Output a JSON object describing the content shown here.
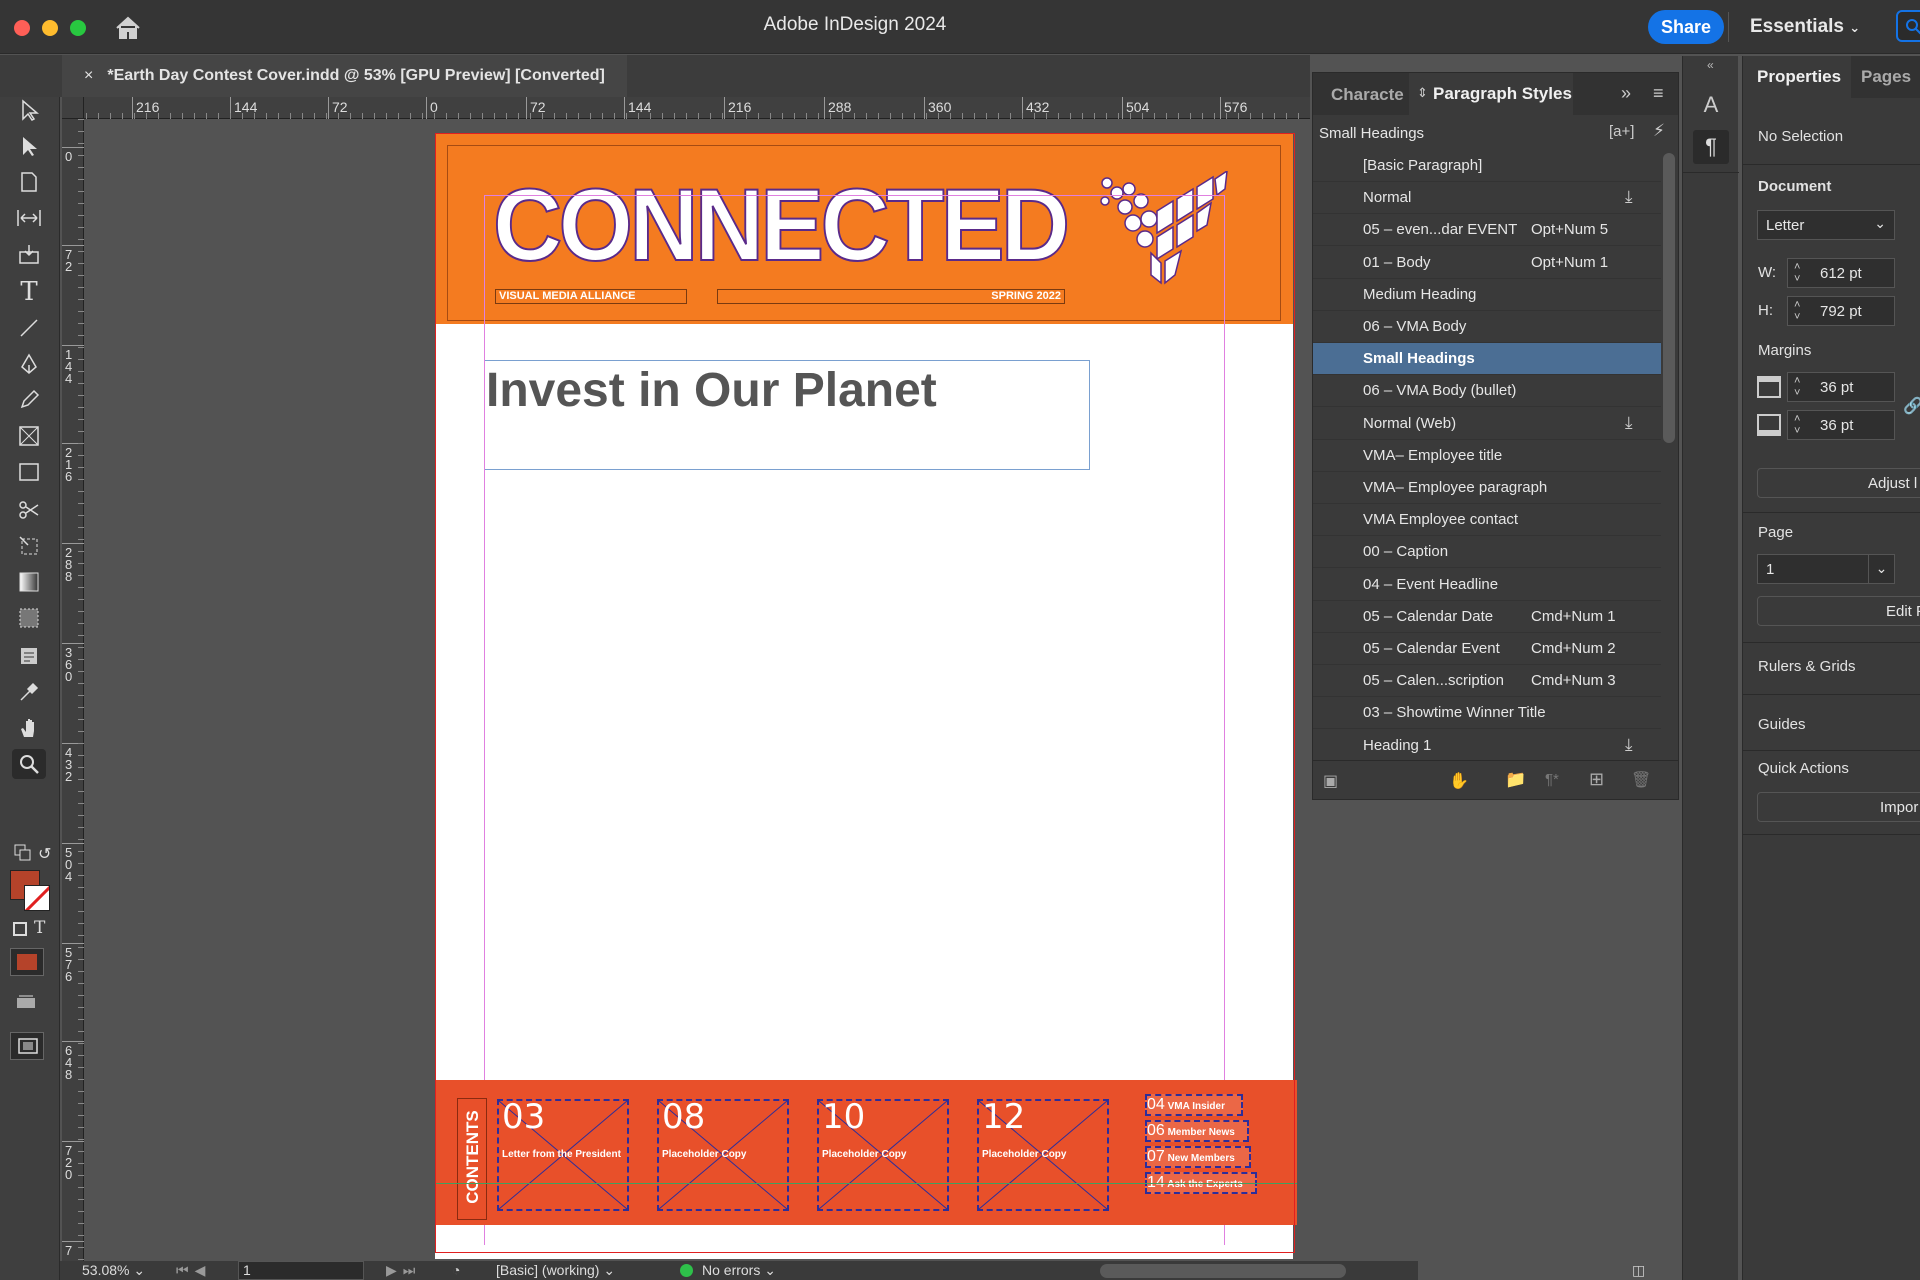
{
  "app": {
    "title": "Adobe InDesign 2024",
    "share_label": "Share",
    "workspace": "Essentials"
  },
  "document": {
    "tab_title": "*Earth Day Contest Cover.indd @ 53% [GPU Preview] [Converted]",
    "close_glyph": "×"
  },
  "rulers": {
    "horizontal": [
      "216",
      "144",
      "72",
      "0",
      "72",
      "144",
      "216",
      "288",
      "360",
      "432",
      "504",
      "576"
    ],
    "vertical": [
      "0",
      "72",
      "144",
      "216",
      "288",
      "360",
      "432",
      "504",
      "576",
      "648",
      "720",
      "7"
    ]
  },
  "cover": {
    "masthead": "CONNECTED",
    "org": "VISUAL MEDIA ALLIANCE",
    "issue": "SPRING 2022",
    "headline": "Invest in Our Planet",
    "contents_label": "CONTENTS",
    "toc_boxes": [
      {
        "num": "03",
        "label": "Letter from the President"
      },
      {
        "num": "08",
        "label": "Placeholder Copy"
      },
      {
        "num": "10",
        "label": "Placeholder Copy"
      },
      {
        "num": "12",
        "label": "Placeholder Copy"
      }
    ],
    "toc_list": [
      {
        "num": "04",
        "label": "VMA Insider"
      },
      {
        "num": "06",
        "label": "Member News"
      },
      {
        "num": "07",
        "label": "New Members"
      },
      {
        "num": "14",
        "label": "Ask the Experts"
      }
    ],
    "colors": {
      "orange": "#f47b20",
      "red": "#e8502a"
    }
  },
  "paragraph_styles": {
    "tabs": [
      "Characte",
      "Paragraph Styles"
    ],
    "current": "Small Headings",
    "items": [
      {
        "name": "[Basic Paragraph]",
        "shortcut": "",
        "imported": false
      },
      {
        "name": "Normal",
        "shortcut": "",
        "imported": true
      },
      {
        "name": "05 – even...dar EVENT",
        "shortcut": "Opt+Num 5",
        "imported": false
      },
      {
        "name": "01 – Body",
        "shortcut": "Opt+Num 1",
        "imported": false
      },
      {
        "name": "Medium Heading",
        "shortcut": "",
        "imported": false
      },
      {
        "name": "06 – VMA Body",
        "shortcut": "",
        "imported": false
      },
      {
        "name": "Small Headings",
        "shortcut": "",
        "imported": false,
        "selected": true
      },
      {
        "name": "06 – VMA Body (bullet)",
        "shortcut": "",
        "imported": false
      },
      {
        "name": "Normal (Web)",
        "shortcut": "",
        "imported": true
      },
      {
        "name": "VMA– Employee title",
        "shortcut": "",
        "imported": false
      },
      {
        "name": "VMA– Employee paragraph",
        "shortcut": "",
        "imported": false
      },
      {
        "name": "VMA Employee contact",
        "shortcut": "",
        "imported": false
      },
      {
        "name": "00 – Caption",
        "shortcut": "",
        "imported": false
      },
      {
        "name": "04 – Event Headline",
        "shortcut": "",
        "imported": false
      },
      {
        "name": "05 – Calendar Date",
        "shortcut": "Cmd+Num 1",
        "imported": false
      },
      {
        "name": "05 – Calendar Event",
        "shortcut": "Cmd+Num 2",
        "imported": false
      },
      {
        "name": "05 – Calen...scription",
        "shortcut": "Cmd+Num 3",
        "imported": false
      },
      {
        "name": "03 – Showtime Winner Title",
        "shortcut": "",
        "imported": false
      },
      {
        "name": "Heading 1",
        "shortcut": "",
        "imported": true
      }
    ]
  },
  "properties": {
    "tabs": [
      "Properties",
      "Pages"
    ],
    "selection": "No Selection",
    "document_label": "Document",
    "preset": "Letter",
    "width_label": "W:",
    "width": "612 pt",
    "height_label": "H:",
    "height": "792 pt",
    "margins_label": "Margins",
    "margin_top": "36 pt",
    "margin_bottom": "36 pt",
    "adjust_button": "Adjust l",
    "page_label": "Page",
    "page_value": "1",
    "edit_button": "Edit P",
    "rulers_grids": "Rulers & Grids",
    "guides": "Guides",
    "quick_actions": "Quick Actions",
    "import_button": "Impor"
  },
  "status": {
    "zoom": "53.08%",
    "page": "1",
    "preflight_profile": "[Basic] (working)",
    "errors": "No errors"
  }
}
